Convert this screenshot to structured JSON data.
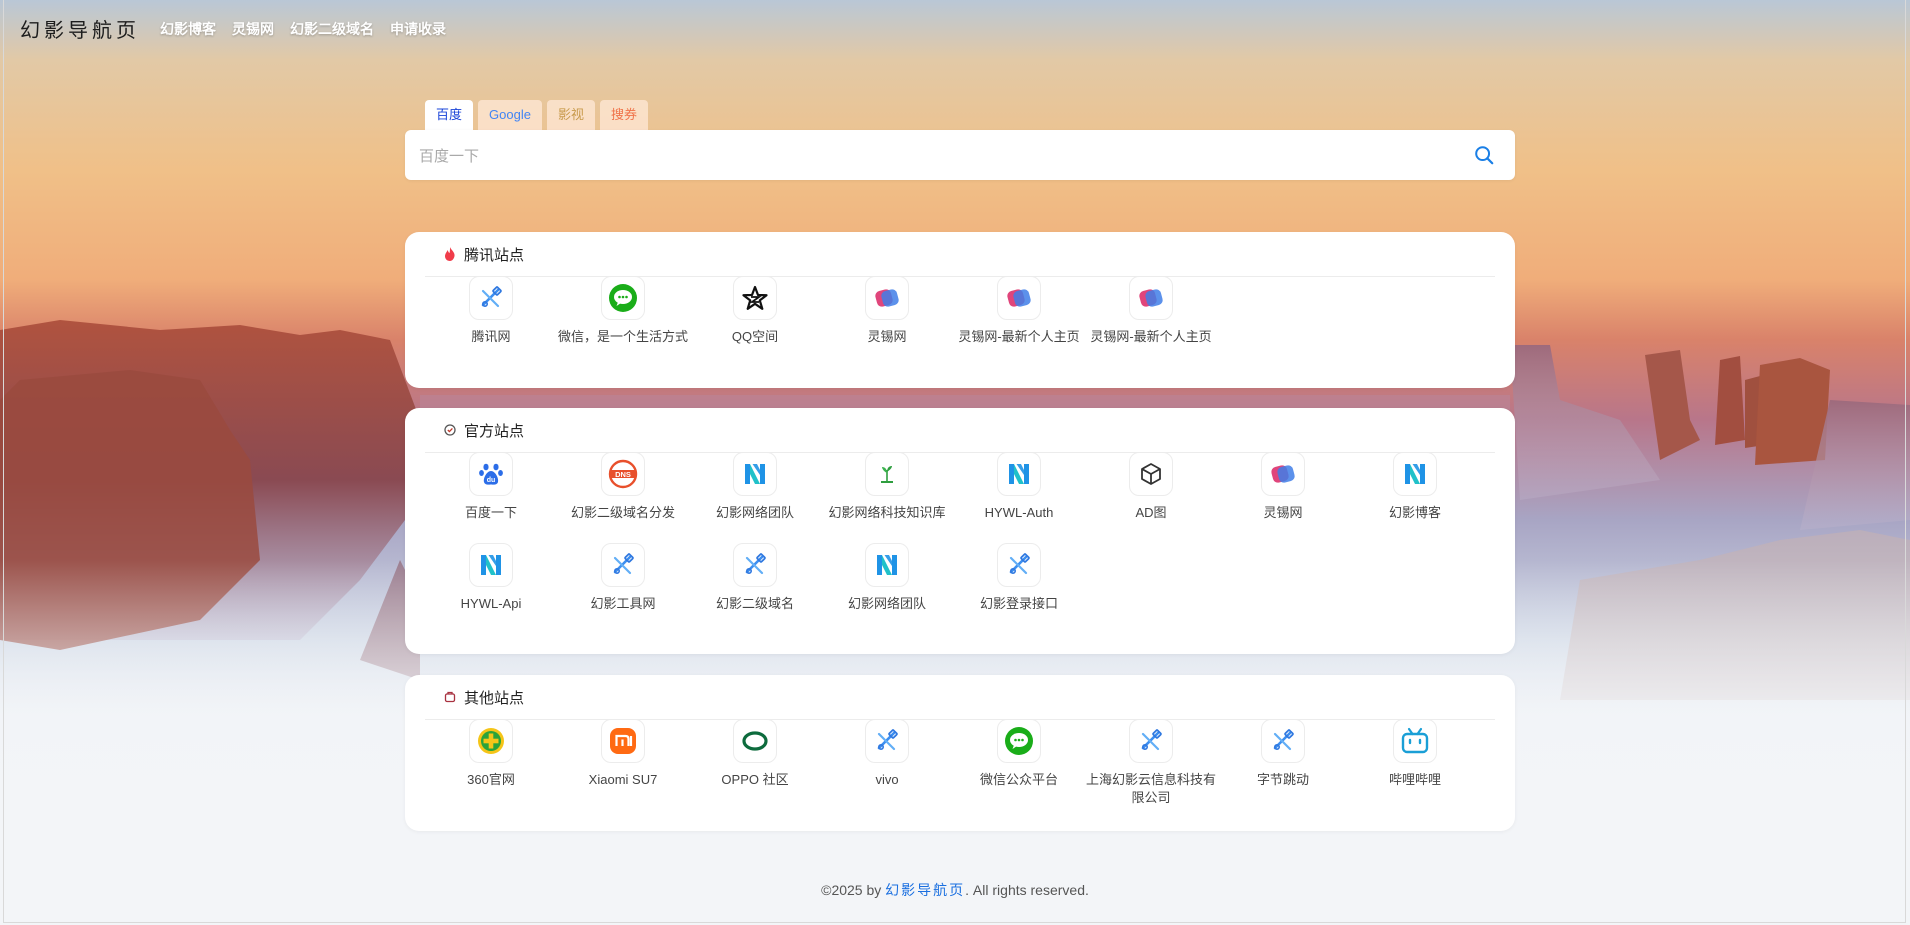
{
  "brand": "幻影导航页",
  "nav": [
    "幻影博客",
    "灵锡网",
    "幻影二级域名",
    "申请收录"
  ],
  "search": {
    "tabs": [
      "百度",
      "Google",
      "影视",
      "搜券"
    ],
    "active_tab": "百度",
    "placeholder": "百度一下"
  },
  "sections": [
    {
      "title": "腾讯站点",
      "icon": "flame-icon",
      "items": [
        {
          "label": "腾讯网",
          "icon": "tool-icon"
        },
        {
          "label": "微信，是一个生活方式",
          "icon": "wechat-icon"
        },
        {
          "label": "QQ空间",
          "icon": "qzone-star-icon"
        },
        {
          "label": "灵锡网",
          "icon": "lingxi-icon"
        },
        {
          "label": "灵锡网-最新个人主页",
          "icon": "lingxi-icon"
        },
        {
          "label": "灵锡网-最新个人主页",
          "icon": "lingxi-icon"
        }
      ]
    },
    {
      "title": "官方站点",
      "icon": "badge-icon",
      "items": [
        {
          "label": "百度一下",
          "icon": "baidu-paw-icon"
        },
        {
          "label": "幻影二级域名分发",
          "icon": "dns-icon"
        },
        {
          "label": "幻影网络团队",
          "icon": "hywl-icon"
        },
        {
          "label": "幻影网络科技知识库",
          "icon": "plant-icon"
        },
        {
          "label": "HYWL-Auth",
          "icon": "hywl-icon"
        },
        {
          "label": "AD图",
          "icon": "cube-icon"
        },
        {
          "label": "灵锡网",
          "icon": "lingxi-icon"
        },
        {
          "label": "幻影博客",
          "icon": "hywl-icon"
        },
        {
          "label": "HYWL-Api",
          "icon": "hywl-icon"
        },
        {
          "label": "幻影工具网",
          "icon": "tool-icon"
        },
        {
          "label": "幻影二级域名",
          "icon": "tool-icon"
        },
        {
          "label": "幻影网络团队",
          "icon": "hywl-icon"
        },
        {
          "label": "幻影登录接口",
          "icon": "tool-icon"
        }
      ]
    },
    {
      "title": "其他站点",
      "icon": "box-icon",
      "items": [
        {
          "label": "360官网",
          "icon": "360-icon"
        },
        {
          "label": "Xiaomi SU7",
          "icon": "xiaomi-icon"
        },
        {
          "label": "OPPO 社区",
          "icon": "oppo-icon"
        },
        {
          "label": "vivo",
          "icon": "tool-icon"
        },
        {
          "label": "微信公众平台",
          "icon": "wechat-icon"
        },
        {
          "label": "上海幻影云信息科技有限公司",
          "icon": "tool-icon"
        },
        {
          "label": "字节跳动",
          "icon": "tool-icon"
        },
        {
          "label": "哔哩哔哩",
          "icon": "bilibili-icon"
        }
      ]
    }
  ],
  "footer": {
    "prefix": "©2025 by ",
    "link": "幻影导航页",
    "suffix": ". All rights reserved."
  }
}
